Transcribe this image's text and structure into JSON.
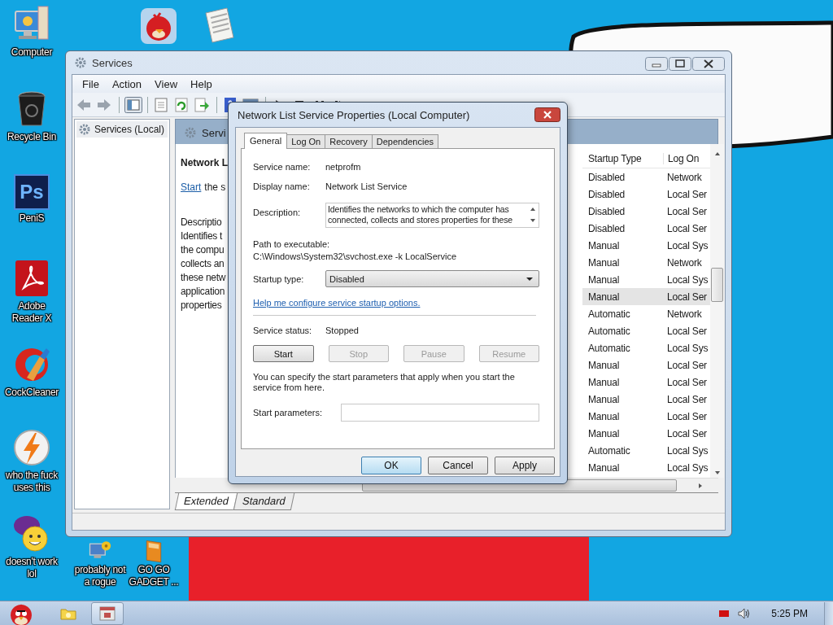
{
  "desktop_icons": [
    {
      "kind": "computer",
      "label": "Computer"
    },
    {
      "kind": "trash",
      "label": "Recycle Bin"
    },
    {
      "kind": "photoshop",
      "glyph": "Ps",
      "label": "PeniS"
    },
    {
      "kind": "pdf",
      "label": "Adobe Reader X"
    },
    {
      "kind": "cleaner",
      "label": "CockCleaner"
    },
    {
      "kind": "bolt",
      "label": "who the fuck uses this"
    },
    {
      "kind": "messenger",
      "label": "doesn't work lol"
    },
    {
      "kind": "gadget",
      "label": "probably not a rogue"
    },
    {
      "kind": "book",
      "label": "GO GO GADGET ..."
    },
    {
      "kind": "bird"
    },
    {
      "kind": "document"
    }
  ],
  "services_window": {
    "title": "Services",
    "menu": [
      "File",
      "Action",
      "View",
      "Help"
    ],
    "tree": [
      {
        "label": "Services (Local)",
        "selected": true
      }
    ],
    "panel_title": "Servi",
    "details": {
      "heading": "Network L",
      "link": "Start",
      "link_rest": "the s",
      "lines": [
        "Descriptio",
        "Identifies t",
        "the compu",
        "collects an",
        "these netw",
        "application",
        "properties"
      ]
    },
    "table": {
      "columns": [
        "Startup Type",
        "Log On"
      ],
      "rows": [
        {
          "cells": [
            "Disabled",
            "Network"
          ],
          "selected": false
        },
        {
          "cells": [
            "Disabled",
            "Local Ser"
          ],
          "selected": false
        },
        {
          "cells": [
            "Disabled",
            "Local Ser"
          ],
          "selected": false
        },
        {
          "cells": [
            "Disabled",
            "Local Ser"
          ],
          "selected": false
        },
        {
          "cells": [
            "Manual",
            "Local Sys"
          ],
          "selected": false
        },
        {
          "cells": [
            "Manual",
            "Network"
          ],
          "selected": false
        },
        {
          "cells": [
            "Manual",
            "Local Sys"
          ],
          "selected": false
        },
        {
          "cells": [
            "Manual",
            "Local Ser"
          ],
          "selected": true
        },
        {
          "cells": [
            "Automatic",
            "Network"
          ],
          "selected": false
        },
        {
          "cells": [
            "Automatic",
            "Local Ser"
          ],
          "selected": false
        },
        {
          "cells": [
            "Automatic",
            "Local Sys"
          ],
          "selected": false
        },
        {
          "cells": [
            "Manual",
            "Local Ser"
          ],
          "selected": false
        },
        {
          "cells": [
            "Manual",
            "Local Ser"
          ],
          "selected": false
        },
        {
          "cells": [
            "Manual",
            "Local Ser"
          ],
          "selected": false
        },
        {
          "cells": [
            "Manual",
            "Local Ser"
          ],
          "selected": false
        },
        {
          "cells": [
            "Manual",
            "Local Ser"
          ],
          "selected": false
        },
        {
          "cells": [
            "Automatic",
            "Local Sys"
          ],
          "selected": false
        },
        {
          "cells": [
            "Manual",
            "Local Sys"
          ],
          "selected": false
        }
      ]
    },
    "view_tabs": [
      {
        "label": "Extended",
        "selected": true
      },
      {
        "label": "Standard",
        "selected": false
      }
    ]
  },
  "dialog": {
    "title": "Network List Service Properties (Local Computer)",
    "tabs": [
      {
        "label": "General",
        "selected": true
      },
      {
        "label": "Log On",
        "selected": false
      },
      {
        "label": "Recovery",
        "selected": false
      },
      {
        "label": "Dependencies",
        "selected": false
      }
    ],
    "fields": [
      {
        "label": "Service name:",
        "value": "netprofm"
      },
      {
        "label": "Display name:",
        "value": "Network List Service"
      }
    ],
    "description": {
      "label": "Description:",
      "value": "Identifies the networks to which the computer has connected, collects and stores properties for these"
    },
    "path": {
      "label": "Path to executable:",
      "value": "C:\\Windows\\System32\\svchost.exe -k LocalService"
    },
    "startup_type": {
      "label": "Startup type:",
      "value": "Disabled"
    },
    "help_link": "Help me configure service startup options.",
    "status": {
      "label": "Service status:",
      "value": "Stopped"
    },
    "control_buttons": [
      {
        "label": "Start",
        "disabled": false
      },
      {
        "label": "Stop",
        "disabled": true
      },
      {
        "label": "Pause",
        "disabled": true
      },
      {
        "label": "Resume",
        "disabled": true
      }
    ],
    "note": "You can specify the start parameters that apply when you start the service from here.",
    "parameters": {
      "label": "Start parameters:"
    },
    "buttons": [
      {
        "label": "OK",
        "default": true
      },
      {
        "label": "Cancel",
        "default": false
      },
      {
        "label": "Apply",
        "default": false
      }
    ]
  },
  "taskbar": {
    "items": [
      {
        "kind": "folder",
        "active": false
      },
      {
        "kind": "services",
        "active": true
      }
    ],
    "tray": [
      {
        "kind": "flag"
      },
      {
        "kind": "speaker"
      }
    ],
    "clock": "5:25 PM"
  }
}
